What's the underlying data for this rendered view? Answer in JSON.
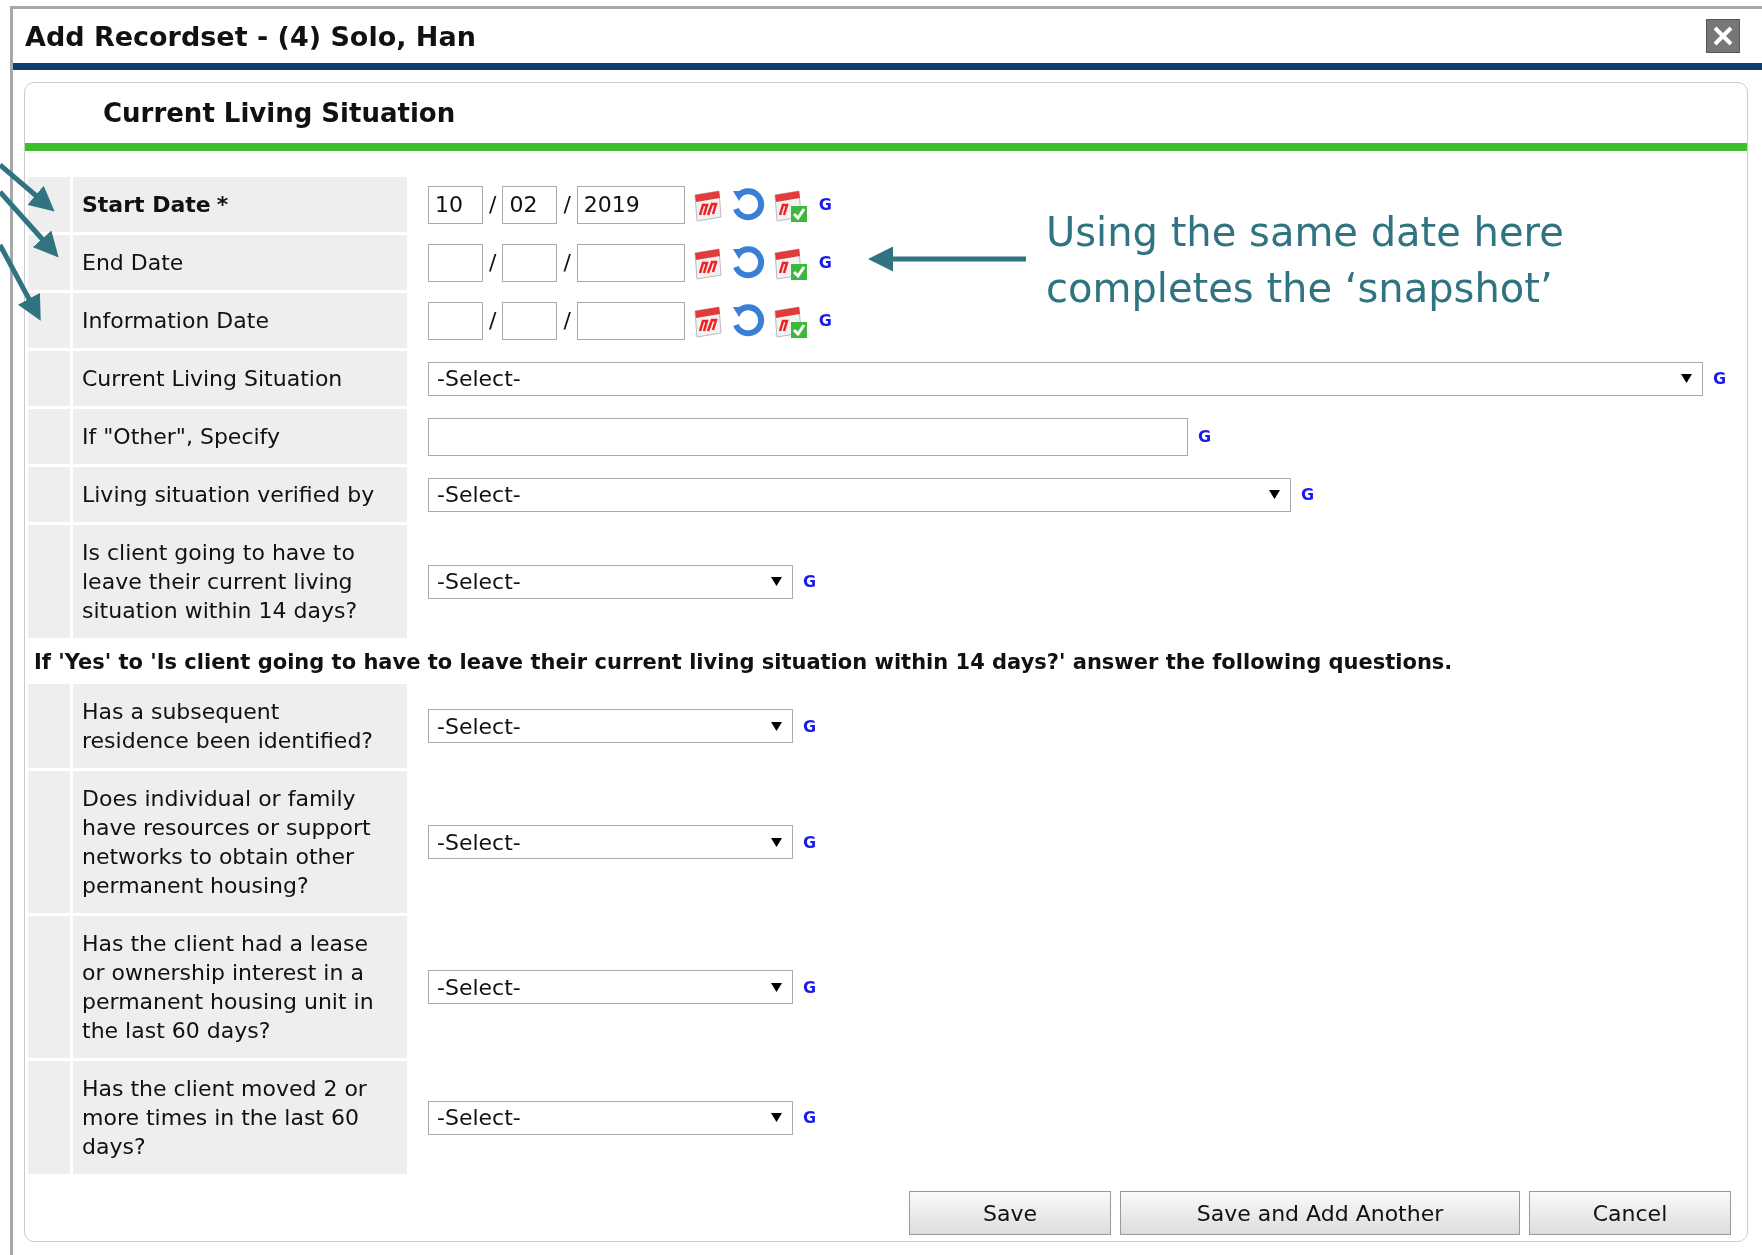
{
  "dialog": {
    "title": "Add Recordset - (4) Solo, Han"
  },
  "section": {
    "title": "Current Living Situation"
  },
  "fields": [
    {
      "kind": "date",
      "label": "Start Date",
      "required_mark": "*",
      "month": "10",
      "day": "02",
      "year": "2019",
      "separators": [
        "/",
        "/"
      ],
      "g_link": "G"
    },
    {
      "kind": "date",
      "label": "End Date",
      "separators": [
        "/",
        "/"
      ],
      "g_link": "G"
    },
    {
      "kind": "date",
      "label": "Information Date",
      "separators": [
        "/",
        "/"
      ],
      "g_link": "G"
    },
    {
      "kind": "select",
      "label": "Current Living Situation",
      "value": "-Select-",
      "g_link": "G"
    },
    {
      "kind": "text",
      "label": "If \"Other\", Specify",
      "g_link": "G"
    },
    {
      "kind": "select",
      "label": "Living situation verified by",
      "value": "-Select-",
      "g_link": "G"
    },
    {
      "kind": "select",
      "label": "Is client going to have to leave their current living situation within 14 days?",
      "value": "-Select-",
      "g_link": "G"
    }
  ],
  "note": "If 'Yes' to 'Is client going to have to leave their current living situation within 14 days?' answer the following questions.",
  "followup_fields": [
    {
      "kind": "select",
      "label": "Has a subsequent residence been identified?",
      "value": "-Select-",
      "g_link": "G"
    },
    {
      "kind": "select",
      "label": "Does individual or family have resources or support networks to obtain other permanent housing?",
      "value": "-Select-",
      "g_link": "G"
    },
    {
      "kind": "select",
      "label": "Has the client had a lease or ownership interest in a permanent housing unit in the last 60 days?",
      "value": "-Select-",
      "g_link": "G"
    },
    {
      "kind": "select",
      "label": "Has the client moved 2 or more times in the last 60 days?",
      "value": "-Select-",
      "g_link": "G"
    }
  ],
  "buttons": [
    "Save",
    "Save and Add Another",
    "Cancel"
  ],
  "callout": {
    "text": "Using the same date here\ncompletes the ‘snapshot’"
  }
}
